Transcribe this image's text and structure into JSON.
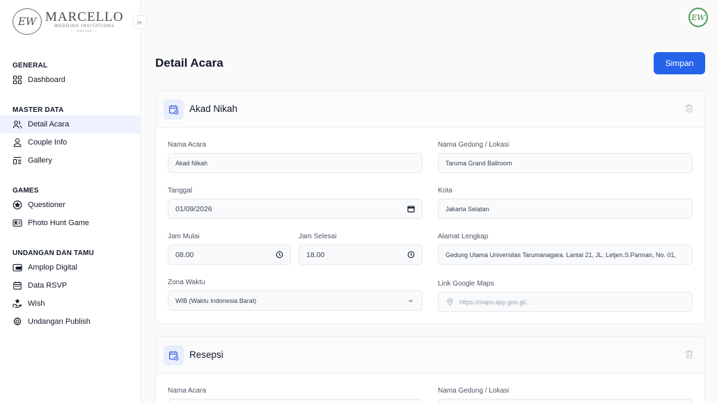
{
  "brand": {
    "monogram": "EW",
    "name": "MARCELLO",
    "tagline": "WEDDING INVITATIONS",
    "sub": "— ONLINE —"
  },
  "header": {
    "avatar_initials": "EW"
  },
  "sidebar": {
    "groups": [
      {
        "title": "GENERAL",
        "items": [
          {
            "label": "Dashboard",
            "icon": "grid-icon"
          }
        ]
      },
      {
        "title": "MASTER DATA",
        "items": [
          {
            "label": "Detail Acara",
            "icon": "users-icon",
            "active": true
          },
          {
            "label": "Couple Info",
            "icon": "user-icon"
          },
          {
            "label": "Gallery",
            "icon": "gallery-icon"
          }
        ]
      },
      {
        "title": "GAMES",
        "items": [
          {
            "label": "Questioner",
            "icon": "star-circle-icon"
          },
          {
            "label": "Photo Hunt Game",
            "icon": "id-card-icon"
          }
        ]
      },
      {
        "title": "UNDANGAN DAN TAMU",
        "items": [
          {
            "label": "Amplop Digital",
            "icon": "wallet-icon"
          },
          {
            "label": "Data RSVP",
            "icon": "calendar-icon"
          },
          {
            "label": "Wish",
            "icon": "gift-hand-icon"
          },
          {
            "label": "Undangan Publish",
            "icon": "gear-icon"
          }
        ]
      }
    ]
  },
  "page": {
    "title": "Detail Acara",
    "save_label": "Simpan"
  },
  "akad": {
    "title": "Akad Nikah",
    "nama_acara_label": "Nama Acara",
    "nama_acara": "Akad Nikah",
    "gedung_label": "Nama Gedung / Lokasi",
    "gedung": "Taruma Grand Ballroom",
    "tanggal_label": "Tanggal",
    "tanggal": "01/09/2026",
    "kota_label": "Kota",
    "kota": "Jakarta Selatan",
    "jam_mulai_label": "Jam Mulai",
    "jam_mulai": "08.00",
    "jam_selesai_label": "Jam Selesai",
    "jam_selesai": "18.00",
    "alamat_label": "Alamat Lengkap",
    "alamat": "Gedung Utama Universitas Tarumanagara. Lantai 21, JL. Letjen.S.Parman, No. 01,",
    "zona_label": "Zona Waktu",
    "zona": "WIB (Waktu Indonesia Barat)",
    "maps_label": "Link Google Maps",
    "maps_placeholder": "https://maps.app.goo.gl/..."
  },
  "resepsi": {
    "title": "Resepsi",
    "nama_acara_label": "Nama Acara",
    "gedung_label": "Nama Gedung / Lokasi"
  },
  "colors": {
    "primary": "#2563eb",
    "active_bg": "#eef2ff",
    "avatar_ring": "#4c9a5c"
  }
}
